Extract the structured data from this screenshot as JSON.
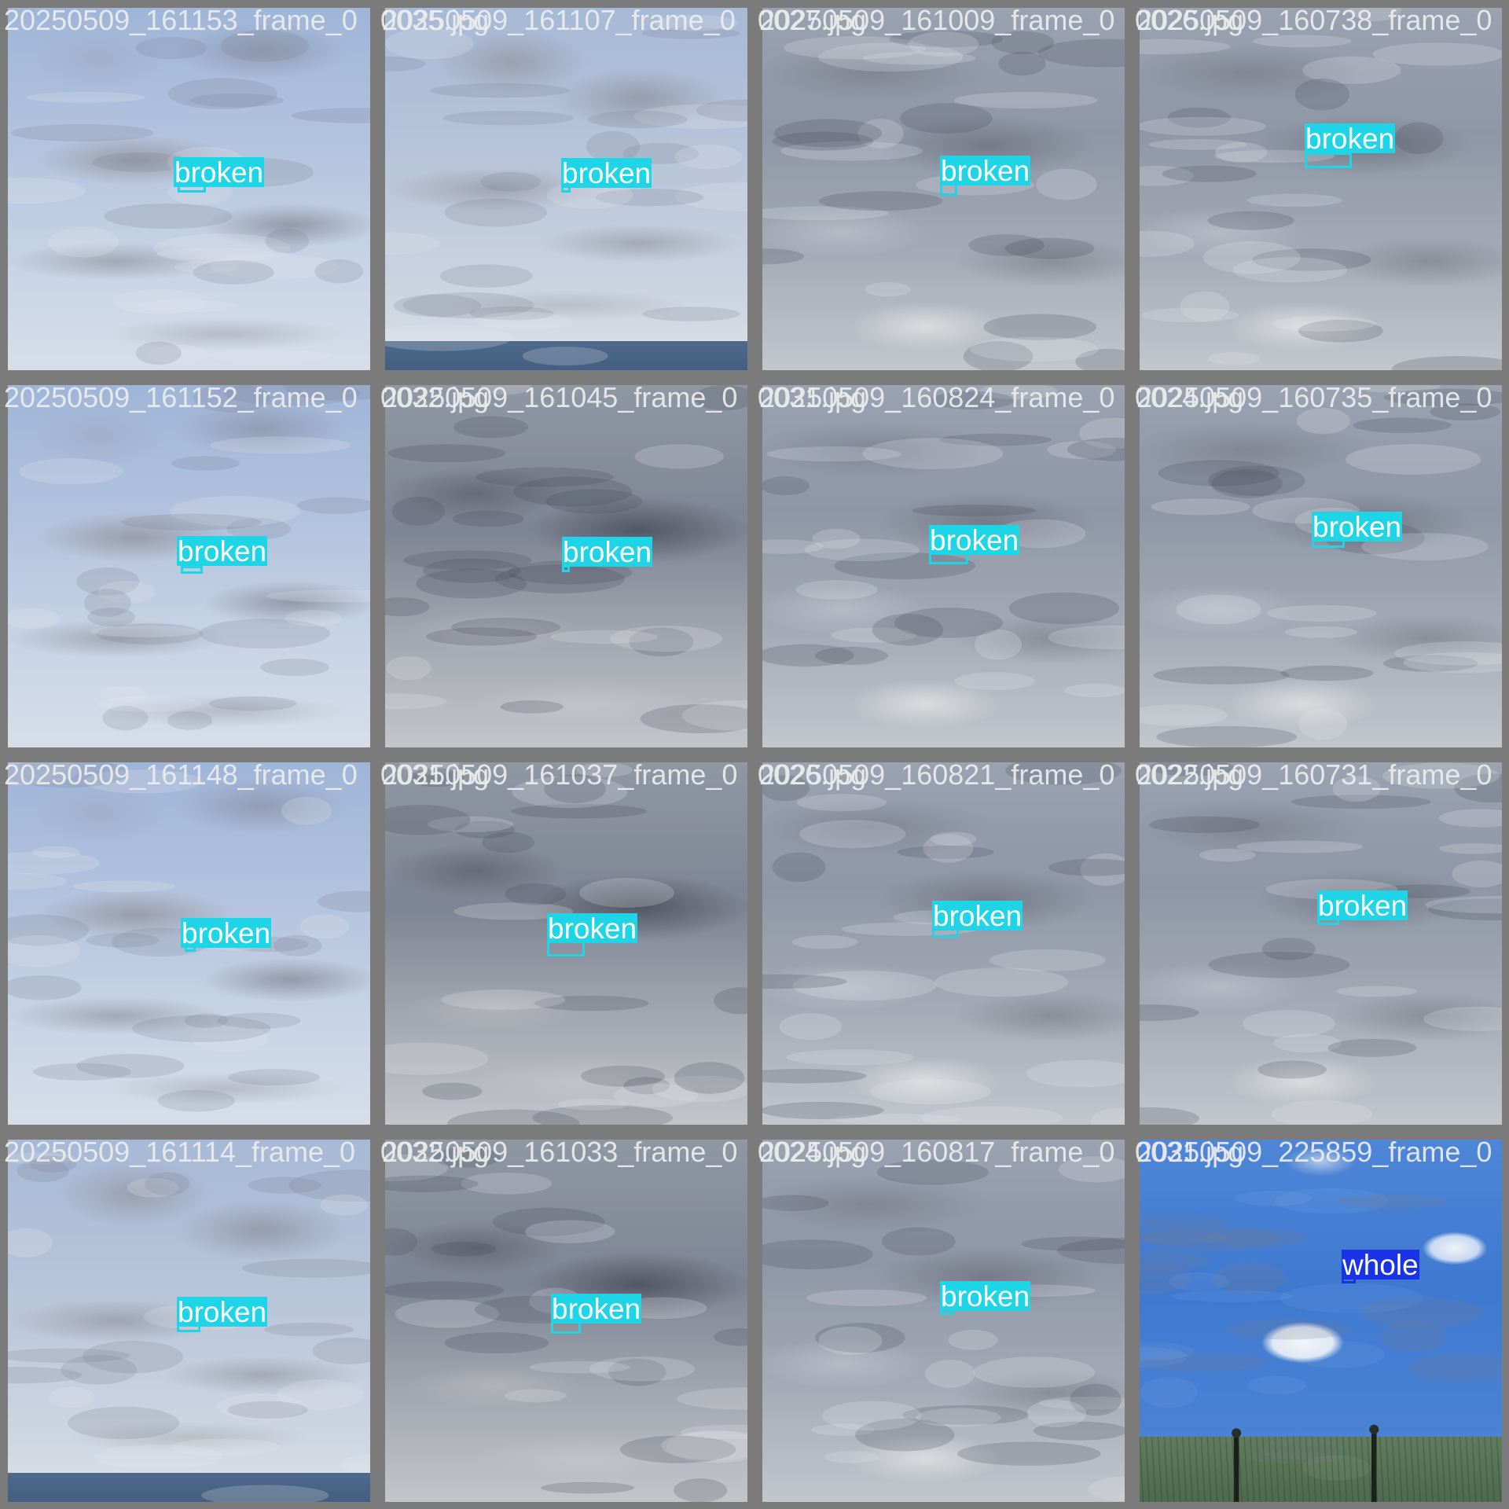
{
  "mosaic": {
    "accent_colors": {
      "broken": "#1ed5e8",
      "whole": "#1a33e6"
    },
    "tiles": [
      {
        "title": "20250509_161153_frame_0",
        "scene": "light",
        "label": "broken",
        "color": "#1ed5e8"
      },
      {
        "title": "0035.jpg",
        "scene": "light-sea",
        "label": "broken",
        "color": "#1ed5e8"
      },
      {
        "title": "0027.jpg",
        "scene": "grey",
        "label": "broken",
        "color": "#1ed5e8"
      },
      {
        "title": "0026.jpg",
        "scene": "grey",
        "label": "broken",
        "color": "#1ed5e8"
      },
      {
        "title": "20250509_161152_frame_0",
        "scene": "light",
        "label": "broken",
        "color": "#1ed5e8"
      },
      {
        "title": "0032.jpg",
        "scene": "dark",
        "label": "broken",
        "color": "#1ed5e8"
      },
      {
        "title": "0031.jpg",
        "scene": "grey",
        "label": "broken",
        "color": "#1ed5e8"
      },
      {
        "title": "0024.jpg",
        "scene": "grey",
        "label": "broken",
        "color": "#1ed5e8"
      },
      {
        "title": "20250509_161148_frame_0",
        "scene": "light",
        "label": "broken",
        "color": "#1ed5e8"
      },
      {
        "title": "0031.jpg",
        "scene": "dark",
        "label": "broken",
        "color": "#1ed5e8"
      },
      {
        "title": "0026.jpg",
        "scene": "grey",
        "label": "broken",
        "color": "#1ed5e8"
      },
      {
        "title": "0022.jpg",
        "scene": "grey",
        "label": "broken",
        "color": "#1ed5e8"
      },
      {
        "title": "20250509_161114_frame_0",
        "scene": "light-sea",
        "label": "broken",
        "color": "#1ed5e8"
      },
      {
        "title": "0032.jpg",
        "scene": "dark",
        "label": "broken",
        "color": "#1ed5e8"
      },
      {
        "title": "0024.jpg",
        "scene": "grey",
        "label": "broken",
        "color": "#1ed5e8"
      },
      {
        "title": "0031.jpg",
        "scene": "blue",
        "label": "whole",
        "color": "#1a33e6"
      }
    ],
    "overlay_titles": [
      "20250509_161107_frame_0",
      "20250509_161009_frame_0",
      "20250509_160738_frame_0",
      "20250509_161045_frame_0",
      "20250509_160824_frame_0",
      "20250509_160735_frame_0",
      "20250509_161037_frame_0",
      "20250509_160821_frame_0",
      "20250509_160731_frame_0",
      "20250509_161033_frame_0",
      "20250509_160817_frame_0",
      "20250509_225859_frame_0"
    ]
  }
}
